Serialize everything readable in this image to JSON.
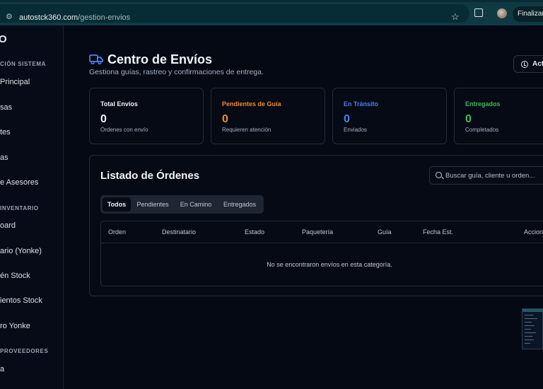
{
  "browser": {
    "url_domain": "autostck360.com",
    "url_path": "/gestion-envios",
    "finalize_label": "Finalizar a"
  },
  "sidebar": {
    "logo_fragment": "O",
    "sections": [
      {
        "label": "CIÓN SISTEMA"
      },
      {
        "label": "INVENTARIO"
      },
      {
        "label": "PROVEEDORES"
      }
    ],
    "items": [
      {
        "label": "Principal"
      },
      {
        "label": "sas"
      },
      {
        "label": "tes"
      },
      {
        "label": "as"
      },
      {
        "label": "e Asesores"
      },
      {
        "label": "oard"
      },
      {
        "label": "ario (Yonke)"
      },
      {
        "label": "én Stock"
      },
      {
        "label": "ientos Stock"
      },
      {
        "label": "ro Yonke"
      },
      {
        "label": "a"
      }
    ]
  },
  "header": {
    "title": "Centro de Envíos",
    "subtitle": "Gestiona guías, rastreo y confirmaciones de entrega.",
    "action_label": "Actu"
  },
  "stats": [
    {
      "label": "Total Envíos",
      "value": "0",
      "note": "Órdenes con envío",
      "color": "#f2f4f8"
    },
    {
      "label": "Pendientes de Guía",
      "value": "0",
      "note": "Requieren atención",
      "color": "#f08c2a"
    },
    {
      "label": "En Tránsito",
      "value": "0",
      "note": "Enviados",
      "color": "#4c7ff0"
    },
    {
      "label": "Entregados",
      "value": "0",
      "note": "Completados",
      "color": "#3fb960"
    }
  ],
  "orders": {
    "title": "Listado de Órdenes",
    "search_placeholder": "Buscar guía, cliente u orden...",
    "tabs": [
      {
        "label": "Todos",
        "active": true
      },
      {
        "label": "Pendientes",
        "active": false
      },
      {
        "label": "En Camino",
        "active": false
      },
      {
        "label": "Entregados",
        "active": false
      }
    ],
    "columns": [
      "Orden",
      "Destinatario",
      "Estado",
      "Paquetería",
      "Guía",
      "Fecha Est.",
      "Accion"
    ],
    "empty_message": "No se encontraron envíos en esta categoría."
  }
}
